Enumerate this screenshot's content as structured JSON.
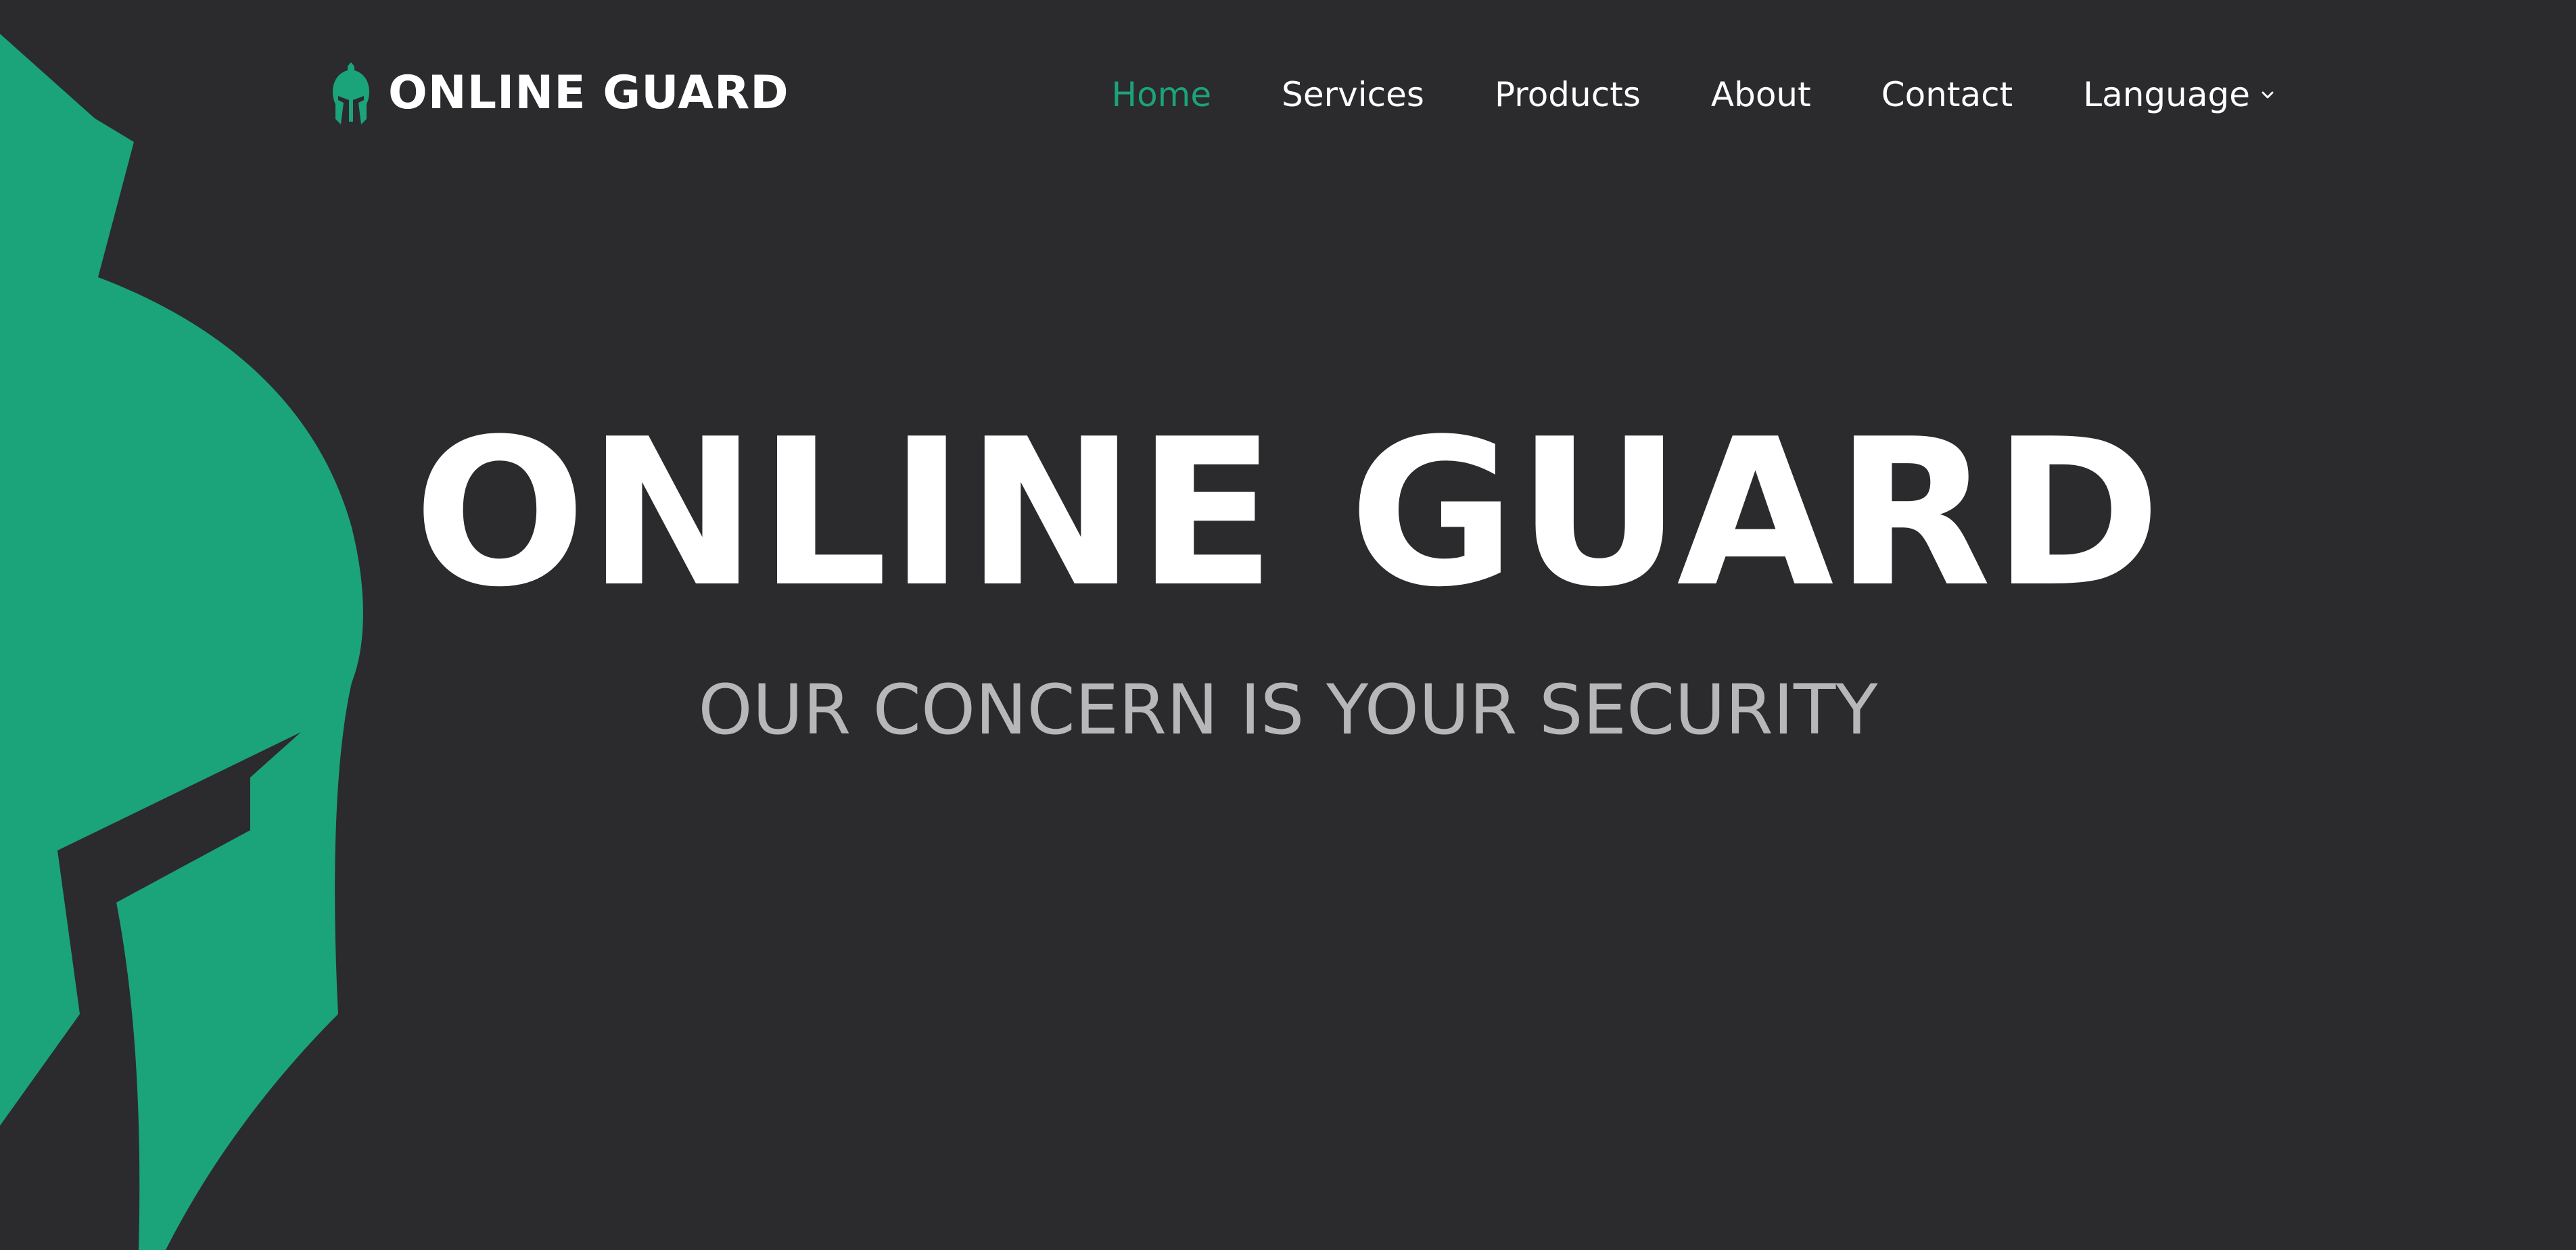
{
  "brand": {
    "logo_text": "ONLINE GUARD",
    "icon": "spartan-helmet-icon",
    "accent_color": "#1ba37a"
  },
  "nav": {
    "items": [
      {
        "label": "Home",
        "active": true
      },
      {
        "label": "Services",
        "active": false
      },
      {
        "label": "Products",
        "active": false
      },
      {
        "label": "About",
        "active": false
      },
      {
        "label": "Contact",
        "active": false
      },
      {
        "label": "Language",
        "active": false,
        "icon": "chevron-down-icon"
      }
    ]
  },
  "hero": {
    "title": "ONLINE GUARD",
    "subtitle": "OUR CONCERN IS YOUR SECURITY",
    "background_graphic": "spartan-helmet-icon"
  },
  "colors": {
    "background": "#2b2a2d",
    "accent": "#1ba37a",
    "text": "#ffffff",
    "subtitle": "#b7b6b9"
  }
}
